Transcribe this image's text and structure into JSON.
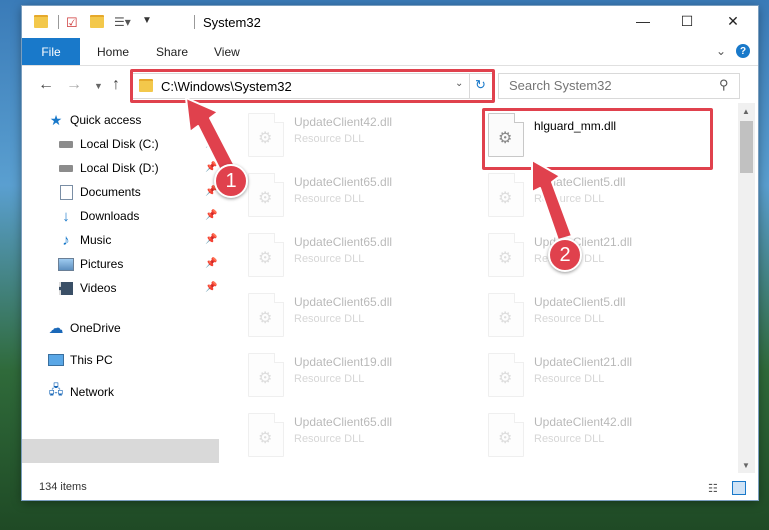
{
  "titlebar": {
    "title": "System32",
    "minimize": "—",
    "maximize": "☐",
    "close": "✕"
  },
  "ribbon": {
    "file": "File",
    "home": "Home",
    "share": "Share",
    "view": "View"
  },
  "nav": {
    "address": "C:\\Windows\\System32",
    "search_placeholder": "Search System32"
  },
  "sidebar": {
    "items": [
      {
        "label": "Quick access",
        "icon": "star-icon"
      },
      {
        "label": "Local Disk (C:)",
        "icon": "drive-icon"
      },
      {
        "label": "Local Disk (D:)",
        "icon": "drive-icon"
      },
      {
        "label": "Documents",
        "icon": "documents-icon"
      },
      {
        "label": "Downloads",
        "icon": "downloads-icon"
      },
      {
        "label": "Music",
        "icon": "music-icon"
      },
      {
        "label": "Pictures",
        "icon": "pictures-icon"
      },
      {
        "label": "Videos",
        "icon": "videos-icon"
      },
      {
        "label": "OneDrive",
        "icon": "cloud-icon"
      },
      {
        "label": "This PC",
        "icon": "computer-icon"
      },
      {
        "label": "Network",
        "icon": "network-icon"
      }
    ]
  },
  "files": [
    {
      "name": "UpdateClient42.dll",
      "type": "Resource DLL"
    },
    {
      "name": "hlguard_mm.dll",
      "type": ""
    },
    {
      "name": "UpdateClient65.dll",
      "type": "Resource DLL"
    },
    {
      "name": "UpdateClient5.dll",
      "type": "Resource DLL"
    },
    {
      "name": "UpdateClient65.dll",
      "type": "Resource DLL"
    },
    {
      "name": "UpdateClient21.dll",
      "type": "Resource DLL"
    },
    {
      "name": "UpdateClient65.dll",
      "type": "Resource DLL"
    },
    {
      "name": "UpdateClient5.dll",
      "type": "Resource DLL"
    },
    {
      "name": "UpdateClient19.dll",
      "type": "Resource DLL"
    },
    {
      "name": "UpdateClient21.dll",
      "type": "Resource DLL"
    },
    {
      "name": "UpdateClient65.dll",
      "type": "Resource DLL"
    },
    {
      "name": "UpdateClient42.dll",
      "type": "Resource DLL"
    }
  ],
  "status": {
    "count": "134 items"
  },
  "annotations": {
    "step1": "1",
    "step2": "2",
    "accent": "#e0414d"
  }
}
